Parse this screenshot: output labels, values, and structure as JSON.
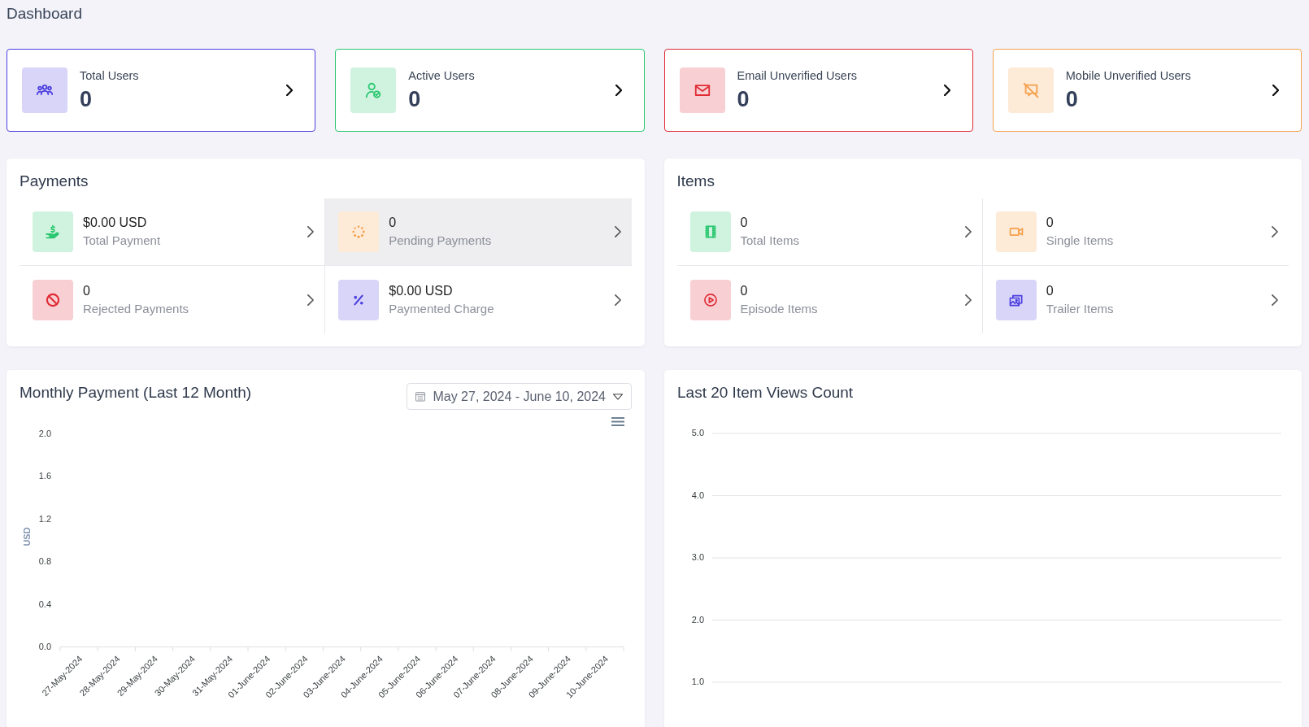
{
  "page": {
    "title": "Dashboard"
  },
  "stat_cards": [
    {
      "label": "Total Users",
      "value": "0",
      "color": "#4c3ee0"
    },
    {
      "label": "Active Users",
      "value": "0",
      "color": "#28c76f"
    },
    {
      "label": "Email Unverified Users",
      "value": "0",
      "color": "#e02b35"
    },
    {
      "label": "Mobile Unverified Users",
      "value": "0",
      "color": "#f5a04b"
    }
  ],
  "payments": {
    "title": "Payments",
    "items": [
      {
        "value": "$0.00 USD",
        "label": "Total Payment",
        "color": "#28c76f",
        "highlighted": false
      },
      {
        "value": "0",
        "label": "Pending Payments",
        "color": "#f5a04b",
        "highlighted": true
      },
      {
        "value": "0",
        "label": "Rejected Payments",
        "color": "#e02b35",
        "highlighted": false
      },
      {
        "value": "$0.00 USD",
        "label": "Paymented Charge",
        "color": "#4c3ee0",
        "highlighted": false
      }
    ]
  },
  "items": {
    "title": "Items",
    "items": [
      {
        "value": "0",
        "label": "Total Items",
        "color": "#28c76f",
        "highlighted": false
      },
      {
        "value": "0",
        "label": "Single Items",
        "color": "#f5a04b",
        "highlighted": false
      },
      {
        "value": "0",
        "label": "Episode Items",
        "color": "#e02b35",
        "highlighted": false
      },
      {
        "value": "0",
        "label": "Trailer Items",
        "color": "#4c3ee0",
        "highlighted": false
      }
    ]
  },
  "payment_chart": {
    "title": "Monthly Payment (Last 12 Month)",
    "date_range": "May 27, 2024 - June 10, 2024",
    "chart_data": {
      "type": "bar",
      "ylabel": "USD",
      "categories": [
        "27-May-2024",
        "28-May-2024",
        "29-May-2024",
        "30-May-2024",
        "31-May-2024",
        "01-June-2024",
        "02-June-2024",
        "03-June-2024",
        "04-June-2024",
        "05-June-2024",
        "06-June-2024",
        "07-June-2024",
        "08-June-2024",
        "09-June-2024",
        "10-June-2024"
      ],
      "ylim": [
        0,
        2
      ],
      "yticks": [
        {
          "value": 0,
          "label": "0.0"
        },
        {
          "value": 0.4,
          "label": "0.4"
        },
        {
          "value": 0.8,
          "label": "0.8"
        },
        {
          "value": 1.2,
          "label": "1.2"
        },
        {
          "value": 1.6,
          "label": "1.6"
        },
        {
          "value": 2,
          "label": "2.0"
        }
      ]
    }
  },
  "views_chart": {
    "title": "Last 20 Item Views Count",
    "chart_data": {
      "type": "line",
      "categories": [
        null,
        null,
        null,
        null,
        null,
        null,
        null,
        null,
        null,
        null,
        null,
        null,
        null,
        null,
        null,
        null,
        null,
        null,
        null,
        null
      ],
      "ylim": [
        1,
        5
      ],
      "yticks": [
        {
          "value": 1,
          "label": "1.0"
        },
        {
          "value": 2,
          "label": "2.0"
        },
        {
          "value": 3,
          "label": "3.0"
        },
        {
          "value": 4,
          "label": "4.0"
        },
        {
          "value": 5,
          "label": "5.0"
        }
      ],
      "grid": true
    }
  }
}
